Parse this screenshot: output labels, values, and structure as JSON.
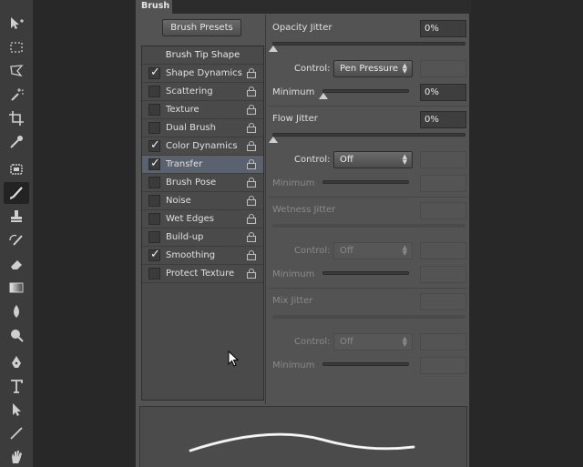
{
  "panel": {
    "tab_label": "Brush",
    "brush_presets_label": "Brush Presets",
    "brush_tip_shape_label": "Brush Tip Shape"
  },
  "list_items": [
    {
      "label": "Shape Dynamics",
      "checked": true,
      "selected": false
    },
    {
      "label": "Scattering",
      "checked": false,
      "selected": false
    },
    {
      "label": "Texture",
      "checked": false,
      "selected": false
    },
    {
      "label": "Dual Brush",
      "checked": false,
      "selected": false
    },
    {
      "label": "Color Dynamics",
      "checked": true,
      "selected": false
    },
    {
      "label": "Transfer",
      "checked": true,
      "selected": true
    },
    {
      "label": "Brush Pose",
      "checked": false,
      "selected": false
    },
    {
      "label": "Noise",
      "checked": false,
      "selected": false
    },
    {
      "label": "Wet Edges",
      "checked": false,
      "selected": false
    },
    {
      "label": "Build-up",
      "checked": false,
      "selected": false
    },
    {
      "label": "Smoothing",
      "checked": true,
      "selected": false
    },
    {
      "label": "Protect Texture",
      "checked": false,
      "selected": false
    }
  ],
  "opacity": {
    "label": "Opacity Jitter",
    "value": "0%",
    "control_label": "Control:",
    "control_value": "Pen Pressure",
    "minimum_label": "Minimum",
    "minimum_value": "0%"
  },
  "flow": {
    "label": "Flow Jitter",
    "value": "0%",
    "control_label": "Control:",
    "control_value": "Off",
    "minimum_label": "Minimum"
  },
  "wetness": {
    "label": "Wetness Jitter",
    "control_label": "Control:",
    "control_value": "Off",
    "minimum_label": "Minimum"
  },
  "mix": {
    "label": "Mix Jitter",
    "control_label": "Control:",
    "control_value": "Off",
    "minimum_label": "Minimum"
  },
  "tools": [
    "move-tool",
    "marquee-tool",
    "lasso-tool",
    "magic-wand-tool",
    "crop-tool",
    "eyedropper-tool",
    "healing-tool",
    "brush-tool",
    "clone-stamp-tool",
    "history-brush-tool",
    "eraser-tool",
    "gradient-tool",
    "blur-tool",
    "dodge-tool",
    "pen-tool",
    "type-tool",
    "path-selection-tool",
    "line-tool",
    "hand-tool"
  ]
}
